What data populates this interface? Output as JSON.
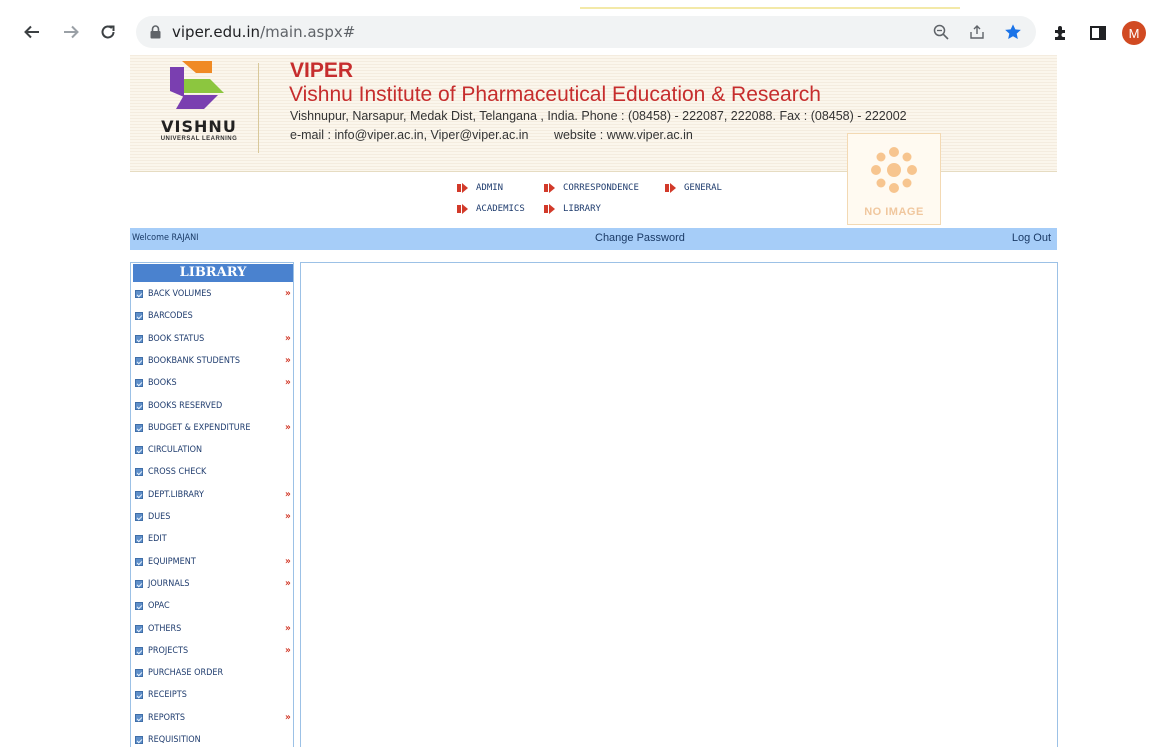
{
  "browser": {
    "url_host": "viper.edu.in",
    "url_path": "/main.aspx#",
    "profile_initial": "M",
    "icons": [
      "back-arrow-icon",
      "forward-arrow-icon",
      "reload-icon",
      "lock-icon",
      "zoom-icon",
      "share-icon",
      "star-icon",
      "extensions-icon",
      "side-panel-icon"
    ],
    "star_color": "#1a73e8"
  },
  "header": {
    "logo_text": "VISHNU",
    "logo_subtext": "UNIVERSAL LEARNING",
    "institute_short": "VIPER",
    "institute_full": "Vishnu Institute of Pharmaceutical Education & Research",
    "address": "Vishnupur, Narsapur, Medak Dist, Telangana , India. Phone : (08458) - 222087, 222088. Fax : (08458) - 222002",
    "email": "e-mail : info@viper.ac.in, Viper@viper.ac.in",
    "website": "website : www.viper.ac.in",
    "brand_color": "#c62d2d"
  },
  "menu": {
    "items": [
      "ADMIN",
      "CORRESPONDENCE",
      "GENERAL",
      "ACADEMICS",
      "LIBRARY"
    ]
  },
  "no_image": {
    "label": "NO IMAGE"
  },
  "welcome_bar": {
    "welcome": "Welcome RAJANI",
    "change_password": "Change Password",
    "logout": "Log Out"
  },
  "sidebar": {
    "title": "LIBRARY",
    "items": [
      {
        "label": "BACK VOLUMES",
        "arrow": "»"
      },
      {
        "label": "BARCODES",
        "arrow": ""
      },
      {
        "label": "BOOK STATUS",
        "arrow": "»"
      },
      {
        "label": "BOOKBANK STUDENTS",
        "arrow": "»"
      },
      {
        "label": "BOOKS",
        "arrow": "»"
      },
      {
        "label": "BOOKS RESERVED",
        "arrow": ""
      },
      {
        "label": "BUDGET & EXPENDITURE",
        "arrow": "»"
      },
      {
        "label": "CIRCULATION",
        "arrow": ""
      },
      {
        "label": "CROSS CHECK",
        "arrow": ""
      },
      {
        "label": "DEPT.LIBRARY",
        "arrow": "»"
      },
      {
        "label": "DUES",
        "arrow": "»"
      },
      {
        "label": "EDIT",
        "arrow": ""
      },
      {
        "label": "EQUIPMENT",
        "arrow": "»"
      },
      {
        "label": "JOURNALS",
        "arrow": "»"
      },
      {
        "label": "OPAC",
        "arrow": ""
      },
      {
        "label": "OTHERS",
        "arrow": "»"
      },
      {
        "label": "PROJECTS",
        "arrow": "»"
      },
      {
        "label": "PURCHASE ORDER",
        "arrow": ""
      },
      {
        "label": "RECEIPTS",
        "arrow": ""
      },
      {
        "label": "REPORTS",
        "arrow": "»"
      },
      {
        "label": "REQUISITION",
        "arrow": ""
      }
    ]
  }
}
